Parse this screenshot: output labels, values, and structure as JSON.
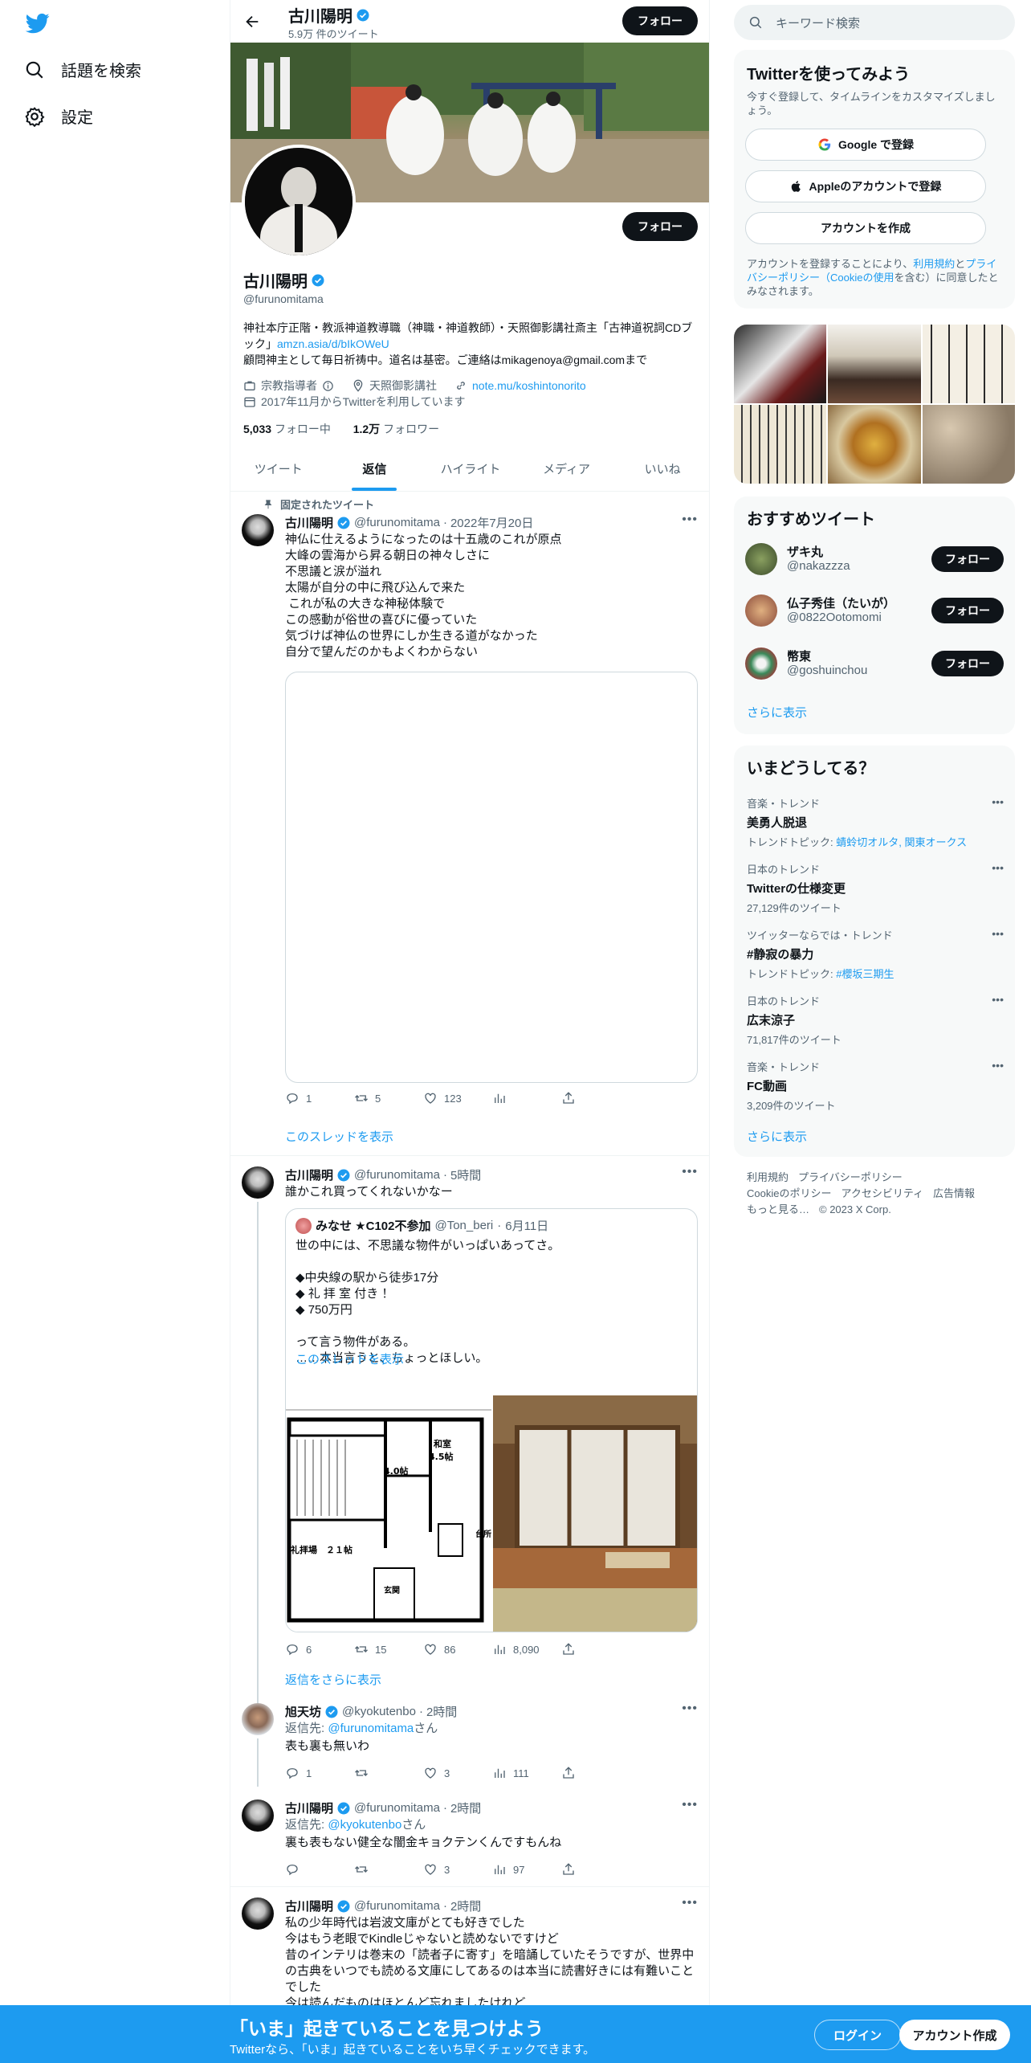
{
  "sidebar": {
    "explore_label": "話題を検索",
    "settings_label": "設定"
  },
  "header": {
    "name": "古川陽明",
    "tweet_count": "5.9万 件のツイート",
    "follow_label": "フォロー"
  },
  "profile": {
    "name": "古川陽明",
    "handle": "@furunomitama",
    "follow_label": "フォロー",
    "bio_line1": "神社本庁正階・教派神道教導職（神職・神道教師）・天照御影講社斎主「古神道祝詞CDブック」",
    "bio_link": "amzn.asia/d/bIkOWeU",
    "bio_line2": "顧問神主として毎日祈祷中。道名は基密。ご連絡はmikagenoya@gmail.comまで",
    "category": "宗教指導者",
    "location": "天照御影講社",
    "url": "note.mu/koshintonorito",
    "joined": "2017年11月からTwitterを利用しています",
    "following_count": "5,033",
    "following_label": "フォロー中",
    "followers_count": "1.2万",
    "followers_label": "フォロワー"
  },
  "tabs": [
    "ツイート",
    "返信",
    "ハイライト",
    "メディア",
    "いいね"
  ],
  "pinned": {
    "label": "固定されたツイート",
    "name": "古川陽明",
    "handle": "@furunomitama",
    "date": "2022年7月20日",
    "text": "神仏に仕えるようになったのは十五歳のこれが原点\n大峰の雲海から昇る朝日の神々しさに\n不思議と涙が溢れ\n太陽が自分の中に飛び込んで来た\n これが私の大きな神秘体験で\nこの感動が俗世の喜びに優っていた\n気づけば神仏の世界にしか生きる道がなかった\n自分で望んだのかもよくわからない",
    "replies": "1",
    "retweets": "5",
    "likes": "123",
    "thread_link": "このスレッドを表示"
  },
  "tweet2": {
    "name": "古川陽明",
    "handle": "@furunomitama",
    "time": "5時間",
    "text": "誰かこれ買ってくれないかなー",
    "quote_name": "みなせ ★C102不参加",
    "quote_handle": "@Ton_beri",
    "quote_date": "6月11日",
    "quote_text": "世の中には、不思議な物件がいっぱいあってさ。\n\n◆中央線の駅から徒歩17分\n◆ 礼 拝 室 付き ！\n◆ 750万円\n\nって言う物件がある。\n……本当言うと、ちょっとほしい。",
    "quote_thread_link": "このスレッドを表示",
    "floorplan_labels": [
      "和室",
      "4.5帖",
      "4.0帖",
      "礼拝場　２１帖",
      "台所",
      "玄関"
    ],
    "replies": "6",
    "retweets": "15",
    "likes": "86",
    "views": "8,090",
    "more_replies": "返信をさらに表示"
  },
  "tweet3": {
    "name": "旭天坊",
    "handle": "@kyokutenbo",
    "time": "2時間",
    "reply_prefix": "返信先:",
    "reply_to": "@furunomitama",
    "reply_suffix": "さん",
    "text": "表も裏も無いわ",
    "replies": "1",
    "likes": "3",
    "views": "111"
  },
  "tweet4": {
    "name": "古川陽明",
    "handle": "@furunomitama",
    "time": "2時間",
    "reply_prefix": "返信先:",
    "reply_to": "@kyokutenbo",
    "reply_suffix": "さん",
    "text": "裏も表もない健全な闇金キョクテンくんですもんね",
    "likes": "3",
    "views": "97"
  },
  "tweet5": {
    "name": "古川陽明",
    "handle": "@furunomitama",
    "time": "2時間",
    "text": "私の少年時代は岩波文庫がとても好きでした\n今はもう老眼でKindleじゃないと読めないですけど\n昔のインテリは巻末の「読者子に寄す」を暗誦していたそうですが、世界中の古典をいつでも読める文庫にしてあるのは本当に読書好きには有難いことでした\n今は読んだものはほとんど忘れましたけれど"
  },
  "search": {
    "placeholder": "キーワード検索"
  },
  "signup": {
    "title": "Twitterを使ってみよう",
    "desc": "今すぐ登録して、タイムラインをカスタマイズしましょう。",
    "google": "Google で登録",
    "apple": "Appleのアカウントで登録",
    "create": "アカウントを作成",
    "terms_pre": "アカウントを登録することにより、",
    "terms_link": "利用規約",
    "terms_and": "と",
    "privacy_link": "プライバシーポリシー（Cookieの使用",
    "terms_post": "を含む）に同意したとみなされます。"
  },
  "suggest": {
    "title": "おすすめツイート",
    "follow_label": "フォロー",
    "users": [
      {
        "name": "ザキ丸",
        "handle": "@nakazzza"
      },
      {
        "name": "仏子秀佳（たいが）",
        "handle": "@0822Ootomomi"
      },
      {
        "name": "幣東",
        "handle": "@goshuinchou"
      }
    ],
    "more": "さらに表示"
  },
  "trends": {
    "title": "いまどうしてる？",
    "items": [
      {
        "context": "音楽・トレンド",
        "name": "美勇人脱退",
        "sub_prefix": "トレンドトピック:",
        "sub_link": "蜻蛉切オルタ, 関東オークス"
      },
      {
        "context": "日本のトレンド",
        "name": "Twitterの仕様変更",
        "sub": "27,129件のツイート"
      },
      {
        "context": "ツイッターならでは・トレンド",
        "name": "#静寂の暴力",
        "sub_prefix": "トレンドトピック:",
        "sub_link": "#櫻坂三期生"
      },
      {
        "context": "日本のトレンド",
        "name": "広末涼子",
        "sub": "71,817件のツイート"
      },
      {
        "context": "音楽・トレンド",
        "name": "FC動画",
        "sub": "3,209件のツイート"
      }
    ],
    "more": "さらに表示"
  },
  "footer": {
    "terms": "利用規約",
    "privacy": "プライバシーポリシー",
    "cookie": "Cookieのポリシー",
    "access": "アクセシビリティ",
    "ads": "広告情報",
    "more": "もっと見る…",
    "copy": "© 2023 X Corp."
  },
  "bottom": {
    "title": "「いま」起きていることを見つけよう",
    "sub": "Twitterなら、「いま」起きていることをいち早くチェックできます。",
    "login": "ログイン",
    "signup": "アカウント作成"
  }
}
